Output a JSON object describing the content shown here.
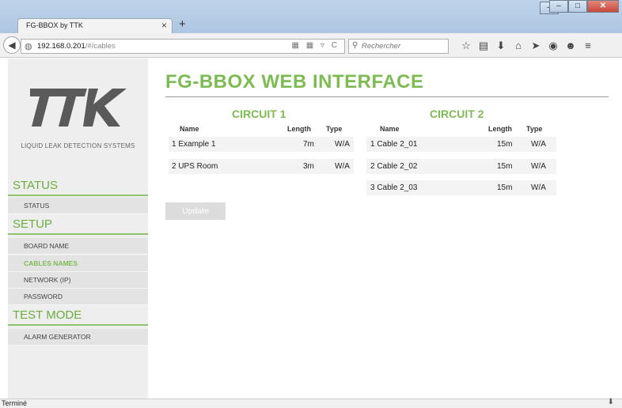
{
  "browser": {
    "tab_title": "FG-BBOX by TTK",
    "tab_close": "×",
    "new_tab": "+",
    "url_host": "192.168.0.201",
    "url_path": "/#/cables",
    "url_icons": "▦ ▦ ▿ C",
    "search_placeholder": "Rechercher",
    "win_min": "–",
    "win_max": "□",
    "win_close": "✕",
    "status_text": "Terminé",
    "toolbar_icons": [
      "☆",
      "▤",
      "⬇",
      "⌂",
      "➤",
      "◉",
      "☻",
      "≡"
    ]
  },
  "sidebar": {
    "logo_text": "TTK",
    "logo_subtitle": "LIQUID LEAK DETECTION SYSTEMS",
    "sections": [
      {
        "title": "STATUS",
        "items": [
          {
            "label": "STATUS",
            "active": false
          }
        ]
      },
      {
        "title": "SETUP",
        "items": [
          {
            "label": "BOARD NAME",
            "active": false
          },
          {
            "label": "CABLES NAMES",
            "active": true
          },
          {
            "label": "NETWORK (IP)",
            "active": false
          },
          {
            "label": "PASSWORD",
            "active": false
          }
        ]
      },
      {
        "title": "TEST MODE",
        "items": [
          {
            "label": "ALARM GENERATOR",
            "active": false
          }
        ]
      }
    ]
  },
  "main": {
    "title": "FG-BBOX WEB INTERFACE",
    "update_label": "Update",
    "accent": "#7dbb53",
    "circuits": [
      {
        "title": "CIRCUIT 1",
        "headers": {
          "name": "Name",
          "length": "Length",
          "type": "Type"
        },
        "rows": [
          {
            "name": "1 Example 1",
            "length": "7m",
            "type": "W/A"
          },
          {
            "name": "2 UPS Room",
            "length": "3m",
            "type": "W/A"
          }
        ]
      },
      {
        "title": "CIRCUIT 2",
        "headers": {
          "name": "Name",
          "length": "Length",
          "type": "Type"
        },
        "rows": [
          {
            "name": "1 Cable 2_01",
            "length": "15m",
            "type": "W/A"
          },
          {
            "name": "2 Cable 2_02",
            "length": "15m",
            "type": "W/A"
          },
          {
            "name": "3 Cable 2_03",
            "length": "15m",
            "type": "W/A"
          }
        ]
      }
    ]
  }
}
